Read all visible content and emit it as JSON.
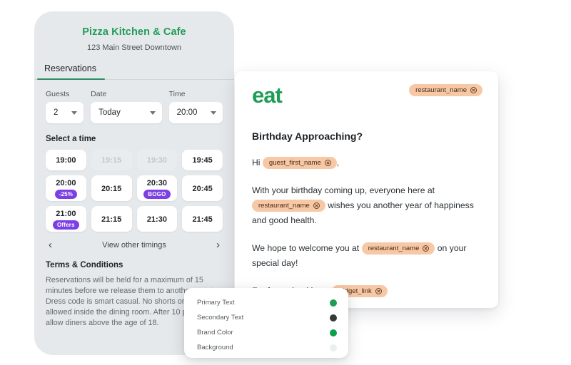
{
  "widget": {
    "restaurant_name": "Pizza Kitchen & Cafe",
    "address": "123 Main Street Downtown",
    "tabs": [
      {
        "label": "Reservations",
        "active": true
      }
    ],
    "fields": [
      {
        "label": "Guests",
        "value": "2"
      },
      {
        "label": "Date",
        "value": "Today"
      },
      {
        "label": "Time",
        "value": "20:00"
      }
    ],
    "select_time_label": "Select a time",
    "slots": [
      {
        "time": "19:00",
        "badge": null,
        "disabled": false
      },
      {
        "time": "19:15",
        "badge": null,
        "disabled": true
      },
      {
        "time": "19:30",
        "badge": null,
        "disabled": true
      },
      {
        "time": "19:45",
        "badge": null,
        "disabled": false
      },
      {
        "time": "20:00",
        "badge": "-25%",
        "disabled": false
      },
      {
        "time": "20:15",
        "badge": null,
        "disabled": false
      },
      {
        "time": "20:30",
        "badge": "BOGO",
        "disabled": false
      },
      {
        "time": "20:45",
        "badge": null,
        "disabled": false
      },
      {
        "time": "21:00",
        "badge": "Offers",
        "disabled": false
      },
      {
        "time": "21:15",
        "badge": null,
        "disabled": false
      },
      {
        "time": "21:30",
        "badge": null,
        "disabled": false
      },
      {
        "time": "21:45",
        "badge": null,
        "disabled": false
      }
    ],
    "pager": {
      "prev": "‹",
      "label": "View other timings",
      "next": "›"
    },
    "terms_title": "Terms & Conditions",
    "terms_body": "Reservations will be held for a maximum of 15 minutes before we release them to another guest. Dress code is smart casual. No shorts or caps allowed inside the dining room. After 10 pm we only allow diners above the age of 18."
  },
  "email": {
    "logo": "eat",
    "header_tag": "restaurant_name",
    "subject": "Birthday Approaching?",
    "greeting_prefix": "Hi",
    "greeting_tag": "guest_first_name",
    "greeting_suffix": ",",
    "p1_a": "With your birthday coming up, everyone here at",
    "p1_tag": "restaurant_name",
    "p1_b": "wishes you another year of happiness and good health.",
    "p2_a": "We hope to welcome you at",
    "p2_tag": "restaurant_name",
    "p2_b": "on your special day!",
    "p3_a": "For future bookings:",
    "p3_tag": "widget_link"
  },
  "color_popup": {
    "rows": [
      {
        "label": "Primary Text",
        "color": "#1f9d57"
      },
      {
        "label": "Secondary Text",
        "color": "#36393c"
      },
      {
        "label": "Brand Color",
        "color": "#0f9d50"
      },
      {
        "label": "Background",
        "color": "#eceeef"
      }
    ]
  },
  "theme": {
    "brand_green": "#1f9d57",
    "badge_purple": "#7b3fe4",
    "tag_peach": "#f7c8a6",
    "panel_gray": "#e6e9eb"
  }
}
